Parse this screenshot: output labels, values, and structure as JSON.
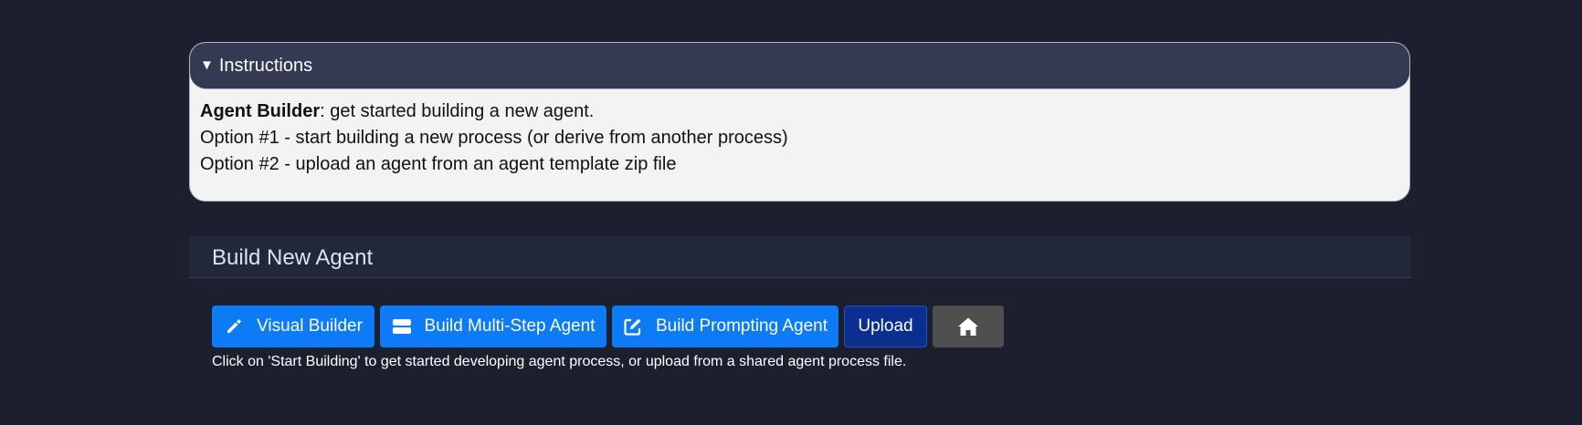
{
  "instructions": {
    "toggle_label": "Instructions",
    "bold_lead": "Agent Builder",
    "lead_rest": ": get started building a new agent.",
    "option1": "Option #1 - start building a new process (or derive from another process)",
    "option2": "Option #2 - upload an agent from an agent template zip file"
  },
  "section": {
    "title": "Build New Agent"
  },
  "buttons": {
    "visual_builder": "Visual Builder",
    "multi_step": "Build Multi-Step Agent",
    "prompting": "Build Prompting Agent",
    "upload": "Upload",
    "home_icon": "home-icon"
  },
  "hint_text": "Click on 'Start Building' to get started developing agent process, or upload from a shared agent process file.",
  "colors": {
    "background": "#1b1f2e",
    "primary_button": "#0d7bf6",
    "upload_button": "#0b2f90",
    "home_button": "#4f4f4f"
  }
}
